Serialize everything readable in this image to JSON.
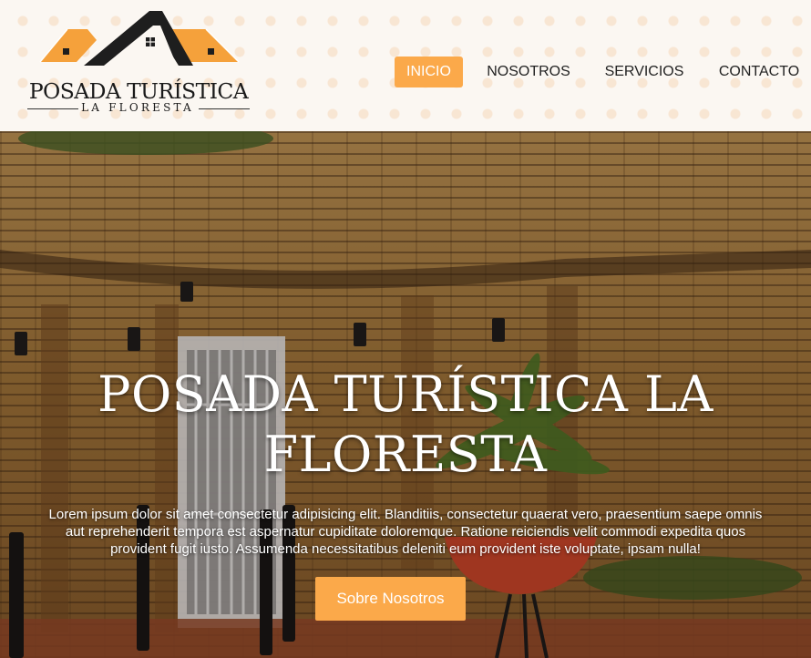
{
  "logo": {
    "title": "POSADA TURÍSTICA",
    "subtitle": "LA FLORESTA",
    "colors": {
      "roof_accent": "#f5a13b",
      "roof_dark": "#1e1e1e"
    }
  },
  "nav": {
    "items": [
      {
        "label": "INICIO",
        "active": true
      },
      {
        "label": "NOSOTROS",
        "active": false
      },
      {
        "label": "SERVICIOS",
        "active": false
      },
      {
        "label": "CONTACTO",
        "active": false
      }
    ]
  },
  "hero": {
    "title_line1": "POSADA TURÍSTICA LA",
    "title_line2": "FLORESTA",
    "text_line1": "Lorem ipsum dolor sit amet consectetur adipisicing elit. Blanditiis, consectetur quaerat vero, praesentium saepe omnis",
    "text_line2": "aut reprehenderit tempora est aspernatur cupiditate doloremque. Ratione reiciendis velit commodi expedita quos",
    "text_line3": "provident fugit iusto. Assumenda necessitatibus deleniti eum provident iste voluptate, ipsam nulla!",
    "button_label": "Sobre Nosotros"
  },
  "colors": {
    "accent": "#fba94a",
    "header_bg": "#fbf7f2"
  }
}
